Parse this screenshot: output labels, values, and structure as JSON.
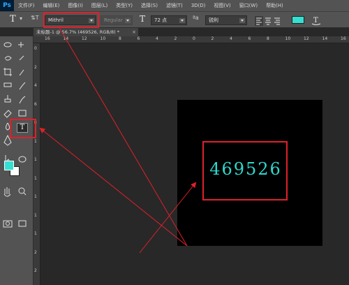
{
  "app": {
    "logo": "Ps"
  },
  "menu": [
    "文件(F)",
    "编辑(E)",
    "图像(I)",
    "图层(L)",
    "类型(Y)",
    "选择(S)",
    "滤镜(T)",
    "3D(D)",
    "视图(V)",
    "窗口(W)",
    "帮助(H)"
  ],
  "options": {
    "tool_glyph": "T",
    "orient_glyph": "⇅T",
    "font_family": "Mithril",
    "font_style": "Regular",
    "size_glyph": "T",
    "font_size": "72 点",
    "aa_glyph": "ªa",
    "antialias": "锐利",
    "text_color": "#34e0d2"
  },
  "document": {
    "tab_title": "未标题-1 @ 56.7% (469526, RGB/8) *",
    "close_glyph": "×"
  },
  "ruler": {
    "top_labels": [
      "16",
      "14",
      "12",
      "10",
      "8",
      "6",
      "4",
      "2",
      "0",
      "2",
      "4",
      "6",
      "8",
      "10",
      "12",
      "14",
      "16"
    ],
    "left_labels": [
      "0",
      "2",
      "4",
      "6",
      "8",
      "1",
      "1",
      "1",
      "1",
      "1",
      "1",
      "2",
      "2"
    ]
  },
  "toolbox": {
    "type_tool_glyph": "T",
    "fg_color": "#34e0d2",
    "bg_color": "#ffffff"
  },
  "canvas": {
    "text": "469526",
    "text_color": "#2fd8cc"
  },
  "annotation_color": "#e0202a"
}
